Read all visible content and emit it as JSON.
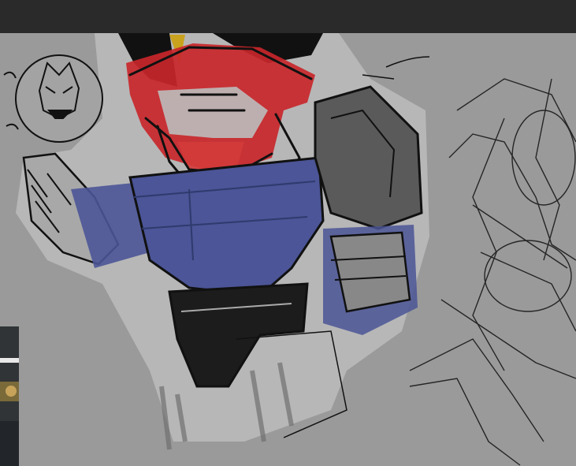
{
  "canvas": {
    "background": "#9a9a9a",
    "artwork": "robot-character-sketch"
  },
  "colors": {
    "topbar": "#2a2a2a",
    "red": "#c8262a",
    "blue": "#4b5597",
    "ink": "#111111"
  }
}
